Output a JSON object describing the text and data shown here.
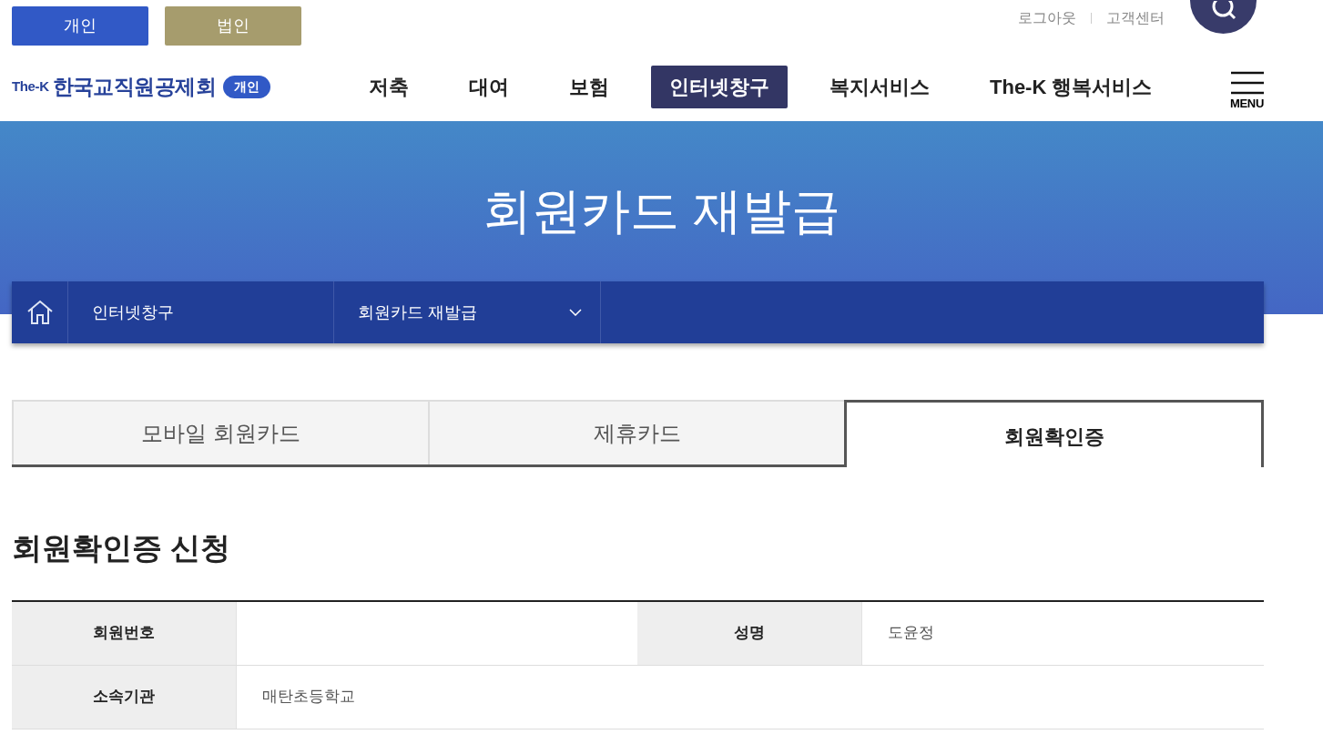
{
  "site_switch": [
    {
      "label": "개인",
      "selected": true
    },
    {
      "label": "법인",
      "selected": false
    }
  ],
  "util_links": [
    "로그아웃",
    "고객센터"
  ],
  "logo": {
    "brand": "The-K",
    "name": "한국교직원공제회",
    "badge": "개인"
  },
  "nav": [
    {
      "label": "저축",
      "selected": false
    },
    {
      "label": "대여",
      "selected": false
    },
    {
      "label": "보험",
      "selected": false
    },
    {
      "label": "인터넷창구",
      "selected": true
    },
    {
      "label": "복지서비스",
      "selected": false
    },
    {
      "label": "The-K 행복서비스",
      "selected": false
    }
  ],
  "menu_label": "MENU",
  "banner_title": "회원카드 재발급",
  "breadcrumb": [
    "인터넷창구",
    "회원카드 재발급"
  ],
  "tabs": [
    {
      "label": "모바일 회원카드",
      "selected": false
    },
    {
      "label": "제휴카드",
      "selected": false
    },
    {
      "label": "회원확인증",
      "selected": true
    }
  ],
  "section_title": "회원확인증 신청",
  "form": [
    {
      "label": "회원번호"
    },
    {
      "label": "성명",
      "value": "도윤정"
    },
    {
      "label": "소속기관",
      "value": "매탄초등학교"
    }
  ]
}
